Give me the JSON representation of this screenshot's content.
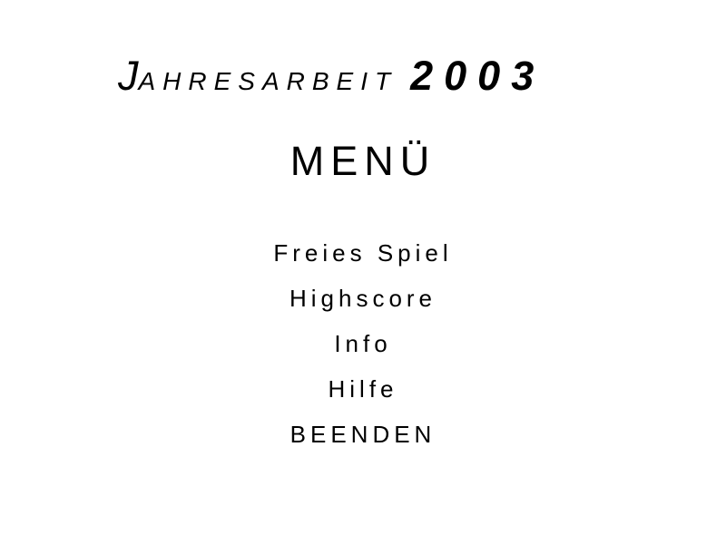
{
  "title": {
    "first_letter": "J",
    "rest": "AHRESARBEIT",
    "year": "2003"
  },
  "heading": "MENÜ",
  "menu": {
    "items": [
      {
        "label": "Freies Spiel"
      },
      {
        "label": "Highscore"
      },
      {
        "label": "Info"
      },
      {
        "label": "Hilfe"
      },
      {
        "label": "BEENDEN"
      }
    ]
  },
  "colors": {
    "background": "#ffffff",
    "text": "#000000"
  }
}
